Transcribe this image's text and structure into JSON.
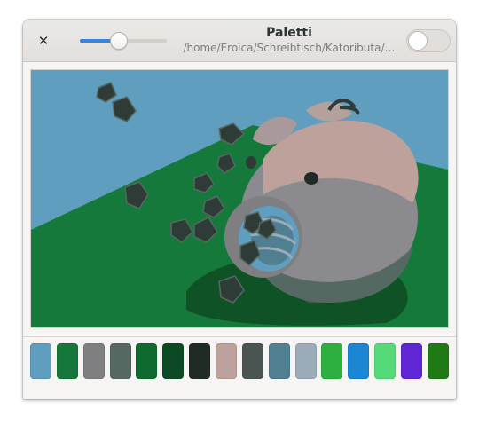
{
  "window": {
    "title": "Paletti",
    "subtitle": "/home/Eroica/Schreibtisch/Katoributa/…"
  },
  "header": {
    "close_glyph": "✕",
    "slider_value": 0.45,
    "switch_on": false
  },
  "icons": {
    "close": "close-icon"
  },
  "colors": {
    "accent": "#3584e4",
    "sky": "#5f9ebf",
    "ground": "#15793b",
    "pig": "#8a8a8f",
    "pig_light": "#bfa19c",
    "shadow": "#0e4c22",
    "rock": "#2f3b37"
  },
  "palette": [
    "#5f9ebf",
    "#16773a",
    "#7f7e81",
    "#556962",
    "#0e6a2e",
    "#0b4a23",
    "#1f2b24",
    "#bea09c",
    "#4a5552",
    "#4f7f90",
    "#9aacb8",
    "#2db040",
    "#1a86d4",
    "#55da7a",
    "#5f26d6",
    "#1f7a16"
  ]
}
